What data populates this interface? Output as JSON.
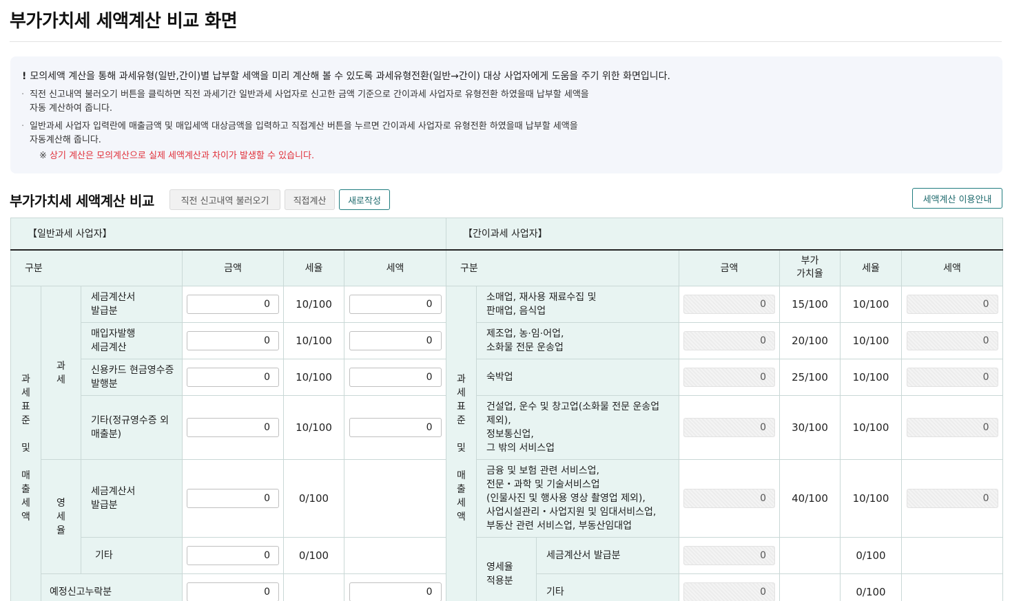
{
  "page": {
    "title": "부가가치세 세액계산 비교 화면"
  },
  "notice": {
    "main": "모의세액 계산을 통해 과세유형(일반,간이)별 납부할 세액을 미리 계산해 볼 수 있도록 과세유형전환(일반→간이) 대상 사업자에게 도움을 주기 위한 화면입니다.",
    "bullet1_line1": "직전 신고내역 불러오기 버튼을 클릭하면 직전 과세기간 일반과세 사업자로 신고한 금액 기준으로 간이과세 사업자로 유형전환 하였을때 납부할 세액을",
    "bullet1_line2": "자동 계산하여 줍니다.",
    "bullet2_line1": "일반과세 사업자 입력란에 매출금액 및 매입세액 대상금액을 입력하고 직접계산 버튼을 누르면 간이과세 사업자로 유형전환 하였을때 납부할 세액을",
    "bullet2_line2": "자동계산해 줍니다.",
    "warning_mark": "※",
    "warning": "상기 계산은 모의계산으로 실제 세액계산과 차이가 발생할 수 있습니다."
  },
  "section": {
    "title": "부가가치세 세액계산 비교",
    "load_button": "직전 신고내역 불러오기",
    "calc_button": "직접계산",
    "new_button": "새로작성",
    "guide_button": "세액계산 이용안내"
  },
  "general": {
    "header": "【일반과세 사업자】",
    "col_category": "구분",
    "col_amount": "금액",
    "col_rate": "세율",
    "col_tax": "세액",
    "group_main": [
      "과",
      "세",
      "표",
      "준",
      "",
      "및",
      "",
      "매",
      "출",
      "세",
      "액"
    ],
    "group_taxed": [
      "과",
      "세"
    ],
    "group_zero": [
      "영",
      "세",
      "율"
    ],
    "rows": [
      {
        "label": "세금계산서\n발급분",
        "amount": "0",
        "rate": "10/100",
        "tax": "0"
      },
      {
        "label": "매입자발행\n세금계산",
        "amount": "0",
        "rate": "10/100",
        "tax": "0"
      },
      {
        "label": "신용카드 현금영수증\n발행분",
        "amount": "0",
        "rate": "10/100",
        "tax": "0"
      },
      {
        "label": "기타(정규영수증 외\n매출분)",
        "amount": "0",
        "rate": "10/100",
        "tax": "0"
      },
      {
        "label": "세금계산서\n발급분",
        "amount": "0",
        "rate": "0/100"
      },
      {
        "label": "기타",
        "amount": "0",
        "rate": "0/100"
      }
    ],
    "omitted": {
      "label": "예정신고누락분",
      "amount": "0",
      "tax": "0"
    }
  },
  "simple": {
    "header": "【간이과세 사업자】",
    "col_category": "구분",
    "col_amount": "금액",
    "col_vat_ratio": "부가\n가치율",
    "col_rate": "세율",
    "col_tax": "세액",
    "group_main": [
      "과",
      "세",
      "표",
      "준",
      "",
      "및",
      "",
      "매",
      "출",
      "세",
      "액"
    ],
    "rows": [
      {
        "label": "소매업, 재사용 재료수집 및\n판매업, 음식업",
        "amount": "0",
        "ratio": "15/100",
        "rate": "10/100",
        "tax": "0"
      },
      {
        "label": "제조업, 농·임·어업,\n소화물 전문 운송업",
        "amount": "0",
        "ratio": "20/100",
        "rate": "10/100",
        "tax": "0"
      },
      {
        "label": "숙박업",
        "amount": "0",
        "ratio": "25/100",
        "rate": "10/100",
        "tax": "0"
      },
      {
        "label": "건설업, 운수 및 창고업(소화물 전문 운송업\n제외),\n정보통신업,\n그 밖의 서비스업",
        "amount": "0",
        "ratio": "30/100",
        "rate": "10/100",
        "tax": "0"
      },
      {
        "label": "금융 및 보험 관련 서비스업,\n전문・과학 및 기술서비스업\n(인물사진 및 행사용 영상 촬영업 제외),\n사업시설관리・사업지원 및 임대서비스업,\n부동산 관련 서비스업, 부동산임대업",
        "amount": "0",
        "ratio": "40/100",
        "rate": "10/100",
        "tax": "0"
      }
    ],
    "zero_group": "영세율\n적용분",
    "zero_rows": [
      {
        "label": "세금계산서 발급분",
        "amount": "0",
        "rate": "0/100"
      },
      {
        "label": "기타",
        "amount": "0",
        "rate": "0/100"
      }
    ]
  }
}
